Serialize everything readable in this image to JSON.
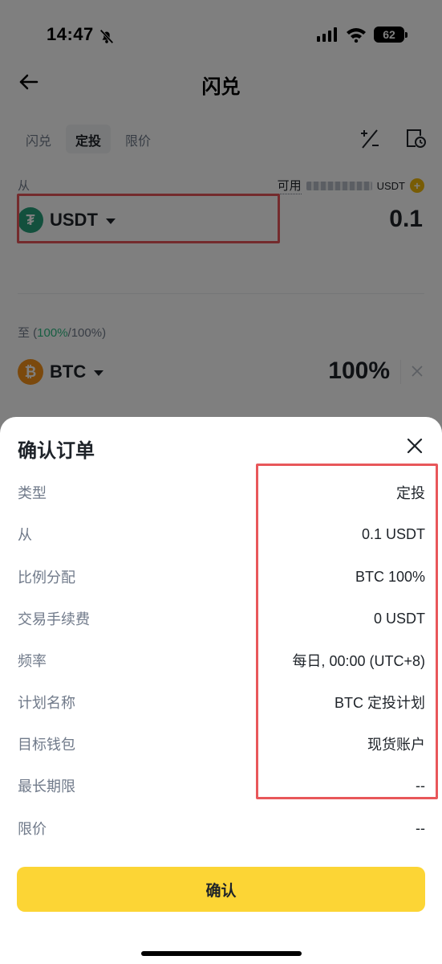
{
  "status_bar": {
    "time": "14:47",
    "battery": "62"
  },
  "header": {
    "title": "闪兑"
  },
  "tabs": [
    {
      "label": "闪兑",
      "active": false
    },
    {
      "label": "定投",
      "active": true
    },
    {
      "label": "限价",
      "active": false
    }
  ],
  "from": {
    "label": "从",
    "available_label": "可用",
    "available_unit": "USDT",
    "coin": "USDT",
    "amount": "0.1"
  },
  "to": {
    "label_prefix": "至 (",
    "label_green": "100%",
    "label_suffix": "/100%)",
    "coin": "BTC",
    "percent": "100%"
  },
  "sheet": {
    "title": "确认订单",
    "rows": [
      {
        "key": "类型",
        "value": "定投"
      },
      {
        "key": "从",
        "value": "0.1 USDT"
      },
      {
        "key": "比例分配",
        "value": "BTC 100%"
      },
      {
        "key": "交易手续费",
        "value": "0 USDT"
      },
      {
        "key": "频率",
        "value": "每日, 00:00 (UTC+8)"
      },
      {
        "key": "计划名称",
        "value": "BTC 定投计划"
      },
      {
        "key": "目标钱包",
        "value": "现货账户"
      },
      {
        "key": "最长期限",
        "value": "--"
      },
      {
        "key": "限价",
        "value": "--"
      }
    ],
    "confirm_label": "确认"
  },
  "colors": {
    "accent": "#fcd535",
    "highlight": "#e8575a",
    "usdt": "#26a17b",
    "btc": "#f7931a",
    "green": "#2ebd85"
  }
}
